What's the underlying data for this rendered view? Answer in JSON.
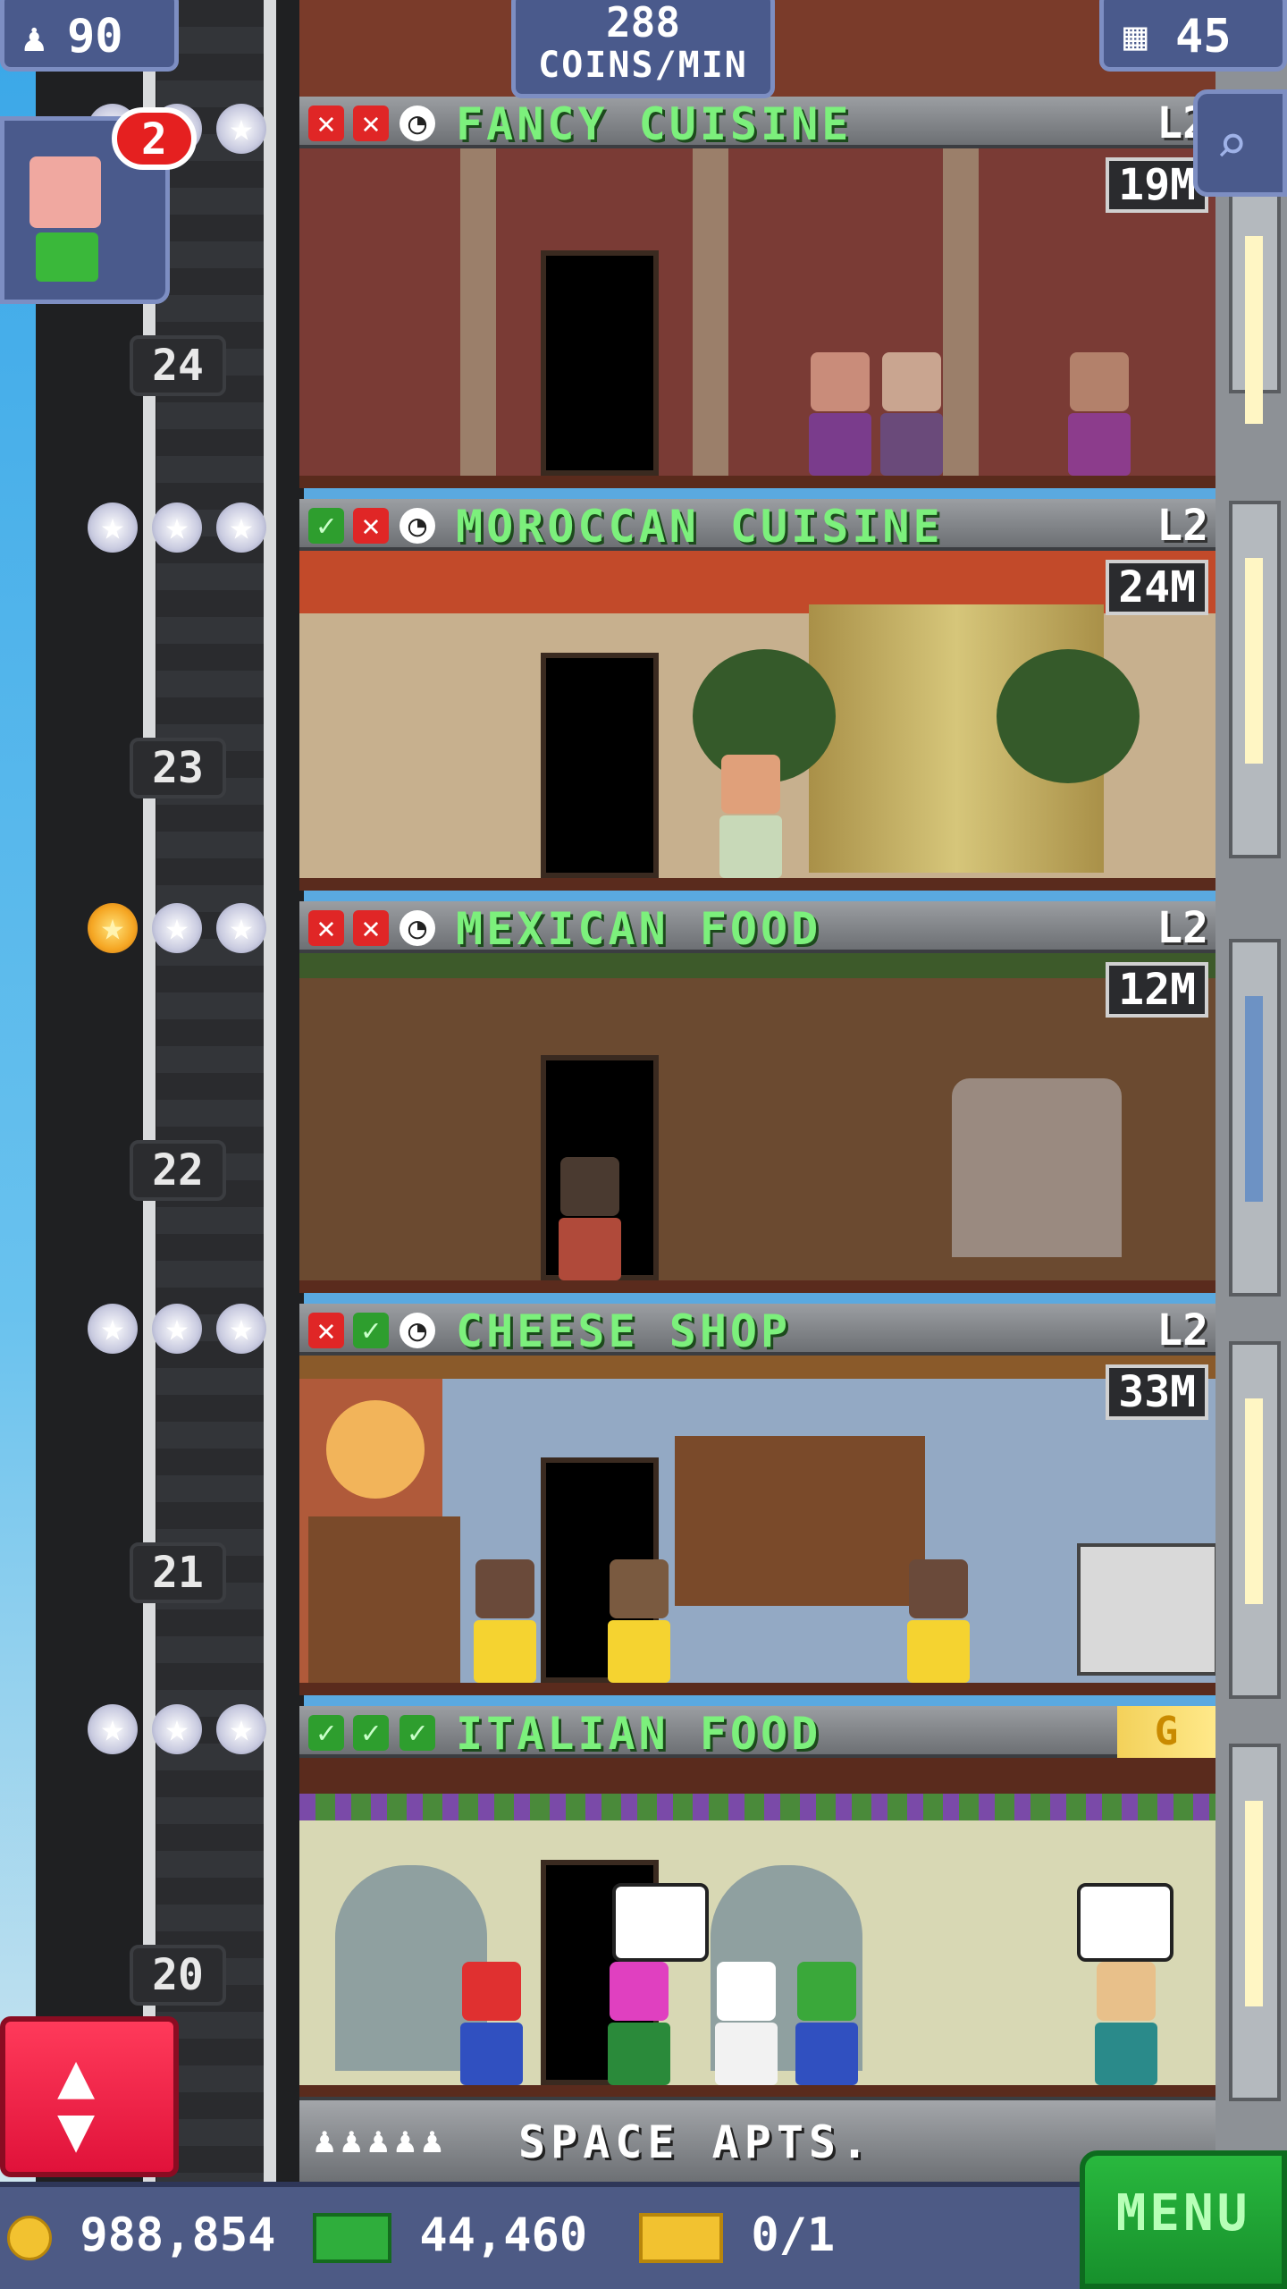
{
  "hud": {
    "population": "90",
    "rate_value": "288",
    "rate_unit": "COINS/MIN",
    "floors_count": "45",
    "visitor_notifications": "2"
  },
  "floors": [
    {
      "number": "24",
      "name": "FANCY CUISINE",
      "level": "L2",
      "value": "19M",
      "stars_filled": 0,
      "status": [
        "x",
        "x",
        "clock"
      ]
    },
    {
      "number": "23",
      "name": "MOROCCAN CUISINE",
      "level": "L2",
      "value": "24M",
      "stars_filled": 0,
      "status": [
        "ok",
        "x",
        "clock"
      ]
    },
    {
      "number": "22",
      "name": "MEXICAN FOOD",
      "level": "L2",
      "value": "12M",
      "stars_filled": 1,
      "status": [
        "x",
        "x",
        "clock"
      ]
    },
    {
      "number": "21",
      "name": "CHEESE SHOP",
      "level": "L2",
      "value": "33M",
      "stars_filled": 0,
      "status": [
        "x",
        "ok",
        "clock"
      ]
    },
    {
      "number": "20",
      "name": "ITALIAN FOOD",
      "level": "",
      "value": "G",
      "stars_filled": 0,
      "status": [
        "ok",
        "ok",
        "ok"
      ]
    }
  ],
  "lobby_strip": {
    "label": "SPACE APTS."
  },
  "bottom": {
    "coins": "988,854",
    "bux": "44,460",
    "tickets": "0/1",
    "menu_label": "MENU"
  },
  "colors": {
    "floor_name": "#7cf07c",
    "menu_button": "#1fa535",
    "elevator_button": "#f0224a",
    "hud_panel": "#4a5a8c"
  },
  "icons": {
    "population": "person-icon",
    "floors": "building-icon",
    "coins": "coin-icon",
    "bux": "bux-icon",
    "tickets": "ticket-icon",
    "search": "magnifier-icon",
    "elevator": "up-down-arrows-icon"
  }
}
